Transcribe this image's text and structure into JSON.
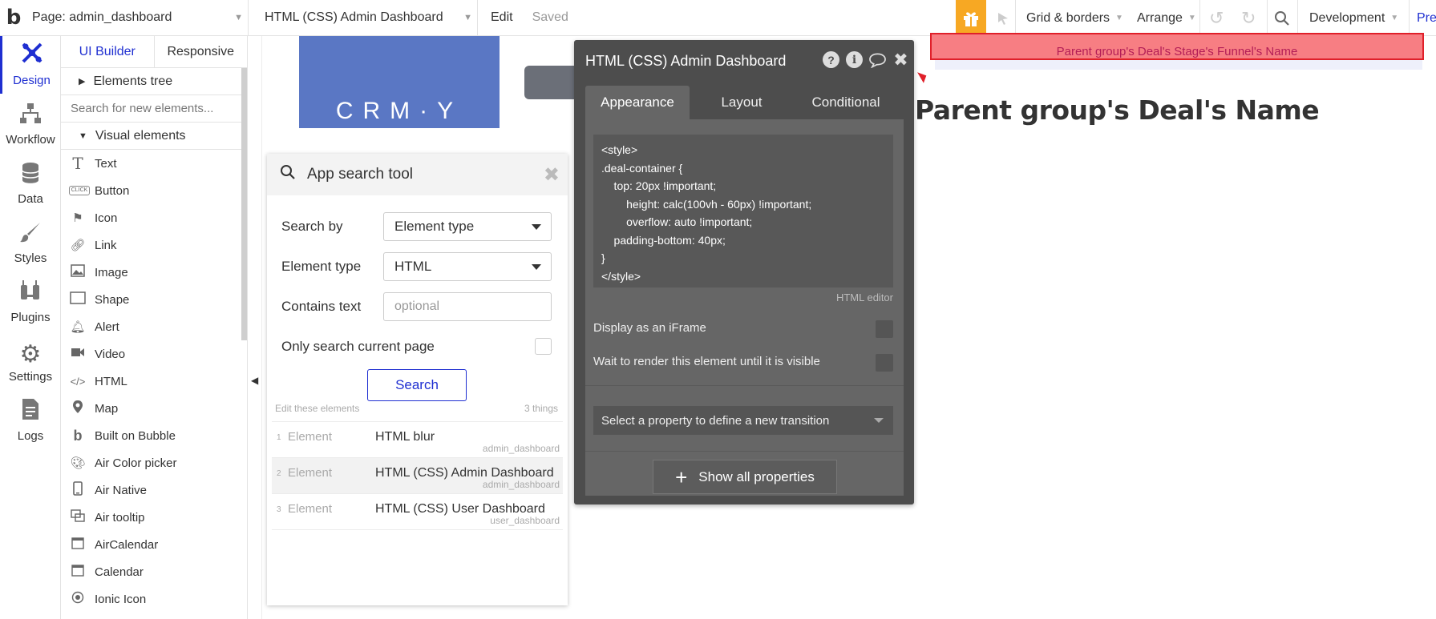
{
  "topbar": {
    "logo": "b",
    "page_selector": "Page: admin_dashboard",
    "element_selector": "HTML (CSS) Admin Dashboard",
    "edit_label": "Edit",
    "saved_label": "Saved",
    "grid_borders": "Grid & borders",
    "arrange": "Arrange",
    "environment": "Development",
    "preview": "Pre"
  },
  "rail": [
    {
      "label": "Design",
      "icon": "design-icon"
    },
    {
      "label": "Workflow",
      "icon": "workflow-icon"
    },
    {
      "label": "Data",
      "icon": "data-icon"
    },
    {
      "label": "Styles",
      "icon": "styles-icon"
    },
    {
      "label": "Plugins",
      "icon": "plugins-icon"
    },
    {
      "label": "Settings",
      "icon": "settings-icon"
    },
    {
      "label": "Logs",
      "icon": "logs-icon"
    }
  ],
  "panel": {
    "tabs": [
      "UI Builder",
      "Responsive"
    ],
    "elements_tree": "Elements tree",
    "search_placeholder": "Search for new elements...",
    "visual_elements": "Visual elements",
    "items": [
      "Text",
      "Button",
      "Icon",
      "Link",
      "Image",
      "Shape",
      "Alert",
      "Video",
      "HTML",
      "Map",
      "Built on Bubble",
      "Air Color picker",
      "Air Native",
      "Air tooltip",
      "AirCalendar",
      "Calendar",
      "Ionic Icon"
    ],
    "button_icon_text": "CLICK"
  },
  "canvas": {
    "logo_text": "CRM·Y",
    "funnel_name": "Parent group's Deal's Stage's Funnel's Name",
    "deal_name": "Parent group's Deal's Name"
  },
  "search_tool": {
    "title": "App search tool",
    "search_by_label": "Search by",
    "search_by_value": "Element type",
    "element_type_label": "Element type",
    "element_type_value": "HTML",
    "contains_text_label": "Contains text",
    "contains_text_placeholder": "optional",
    "only_current_label": "Only search current page",
    "search_button": "Search",
    "edit_note": "Edit these elements",
    "count": "3 things",
    "results": [
      {
        "num": "1",
        "kind": "Element",
        "name": "HTML blur",
        "page": "admin_dashboard"
      },
      {
        "num": "2",
        "kind": "Element",
        "name": "HTML (CSS) Admin Dashboard",
        "page": "admin_dashboard"
      },
      {
        "num": "3",
        "kind": "Element",
        "name": "HTML (CSS) User Dashboard",
        "page": "user_dashboard"
      }
    ]
  },
  "property_editor": {
    "title": "HTML (CSS) Admin Dashboard",
    "tabs": [
      "Appearance",
      "Layout",
      "Conditional"
    ],
    "code": "<style>\n.deal-container {\n    top: 20px !important;\n        height: calc(100vh - 60px) !important;\n        overflow: auto !important;\n    padding-bottom: 40px;\n}\n</style>",
    "html_editor_label": "HTML editor",
    "iframe_label": "Display as an iFrame",
    "wait_render_label": "Wait to render this element until it is visible",
    "transition_placeholder": "Select a property to define a new transition",
    "show_all": "Show all properties"
  }
}
